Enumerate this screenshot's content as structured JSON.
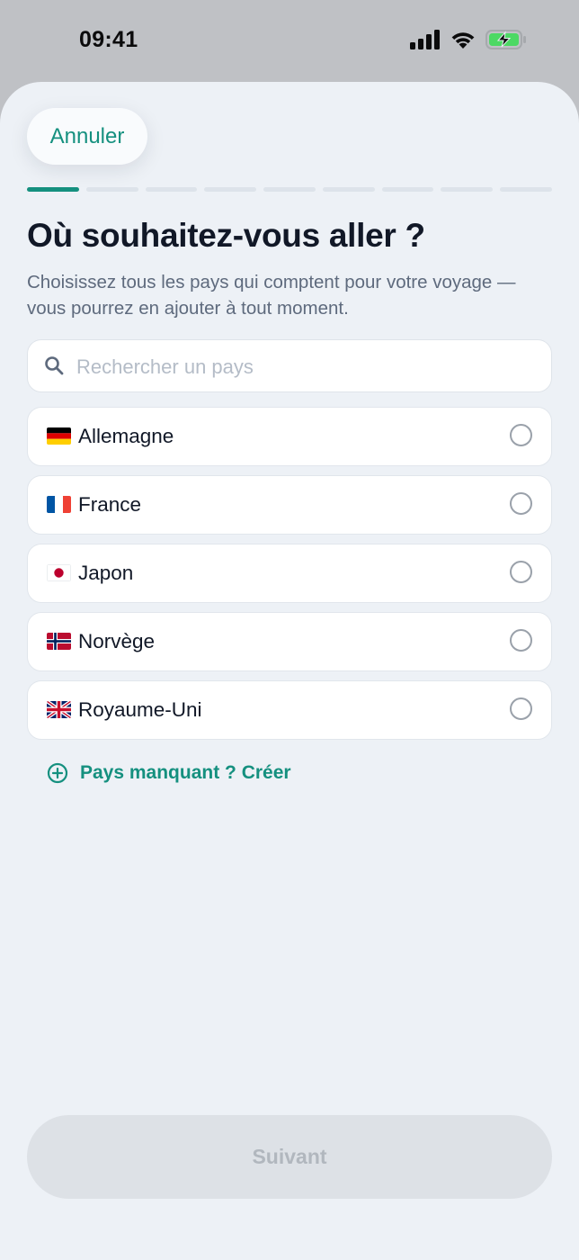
{
  "status_bar": {
    "time": "09:41"
  },
  "header": {
    "cancel_label": "Annuler"
  },
  "progress": {
    "total_steps": 9,
    "current_step": 1
  },
  "title": "Où souhaitez-vous aller ?",
  "subtitle": "Choisissez tous les pays qui comptent pour votre voyage — vous pourrez en ajouter à tout moment.",
  "search": {
    "placeholder": "Rechercher un pays",
    "value": ""
  },
  "countries": [
    {
      "name": "Allemagne",
      "flag": "germany-flag-icon",
      "selected": false
    },
    {
      "name": "France",
      "flag": "france-flag-icon",
      "selected": false
    },
    {
      "name": "Japon",
      "flag": "japan-flag-icon",
      "selected": false
    },
    {
      "name": "Norvège",
      "flag": "norway-flag-icon",
      "selected": false
    },
    {
      "name": "Royaume-Uni",
      "flag": "uk-flag-icon",
      "selected": false
    }
  ],
  "create_link": {
    "label": "Pays manquant ? Créer"
  },
  "footer": {
    "next_label": "Suivant",
    "next_enabled": false
  },
  "colors": {
    "accent": "#15907f",
    "background": "#edf1f6",
    "disabled_button": "#dde1e6"
  }
}
